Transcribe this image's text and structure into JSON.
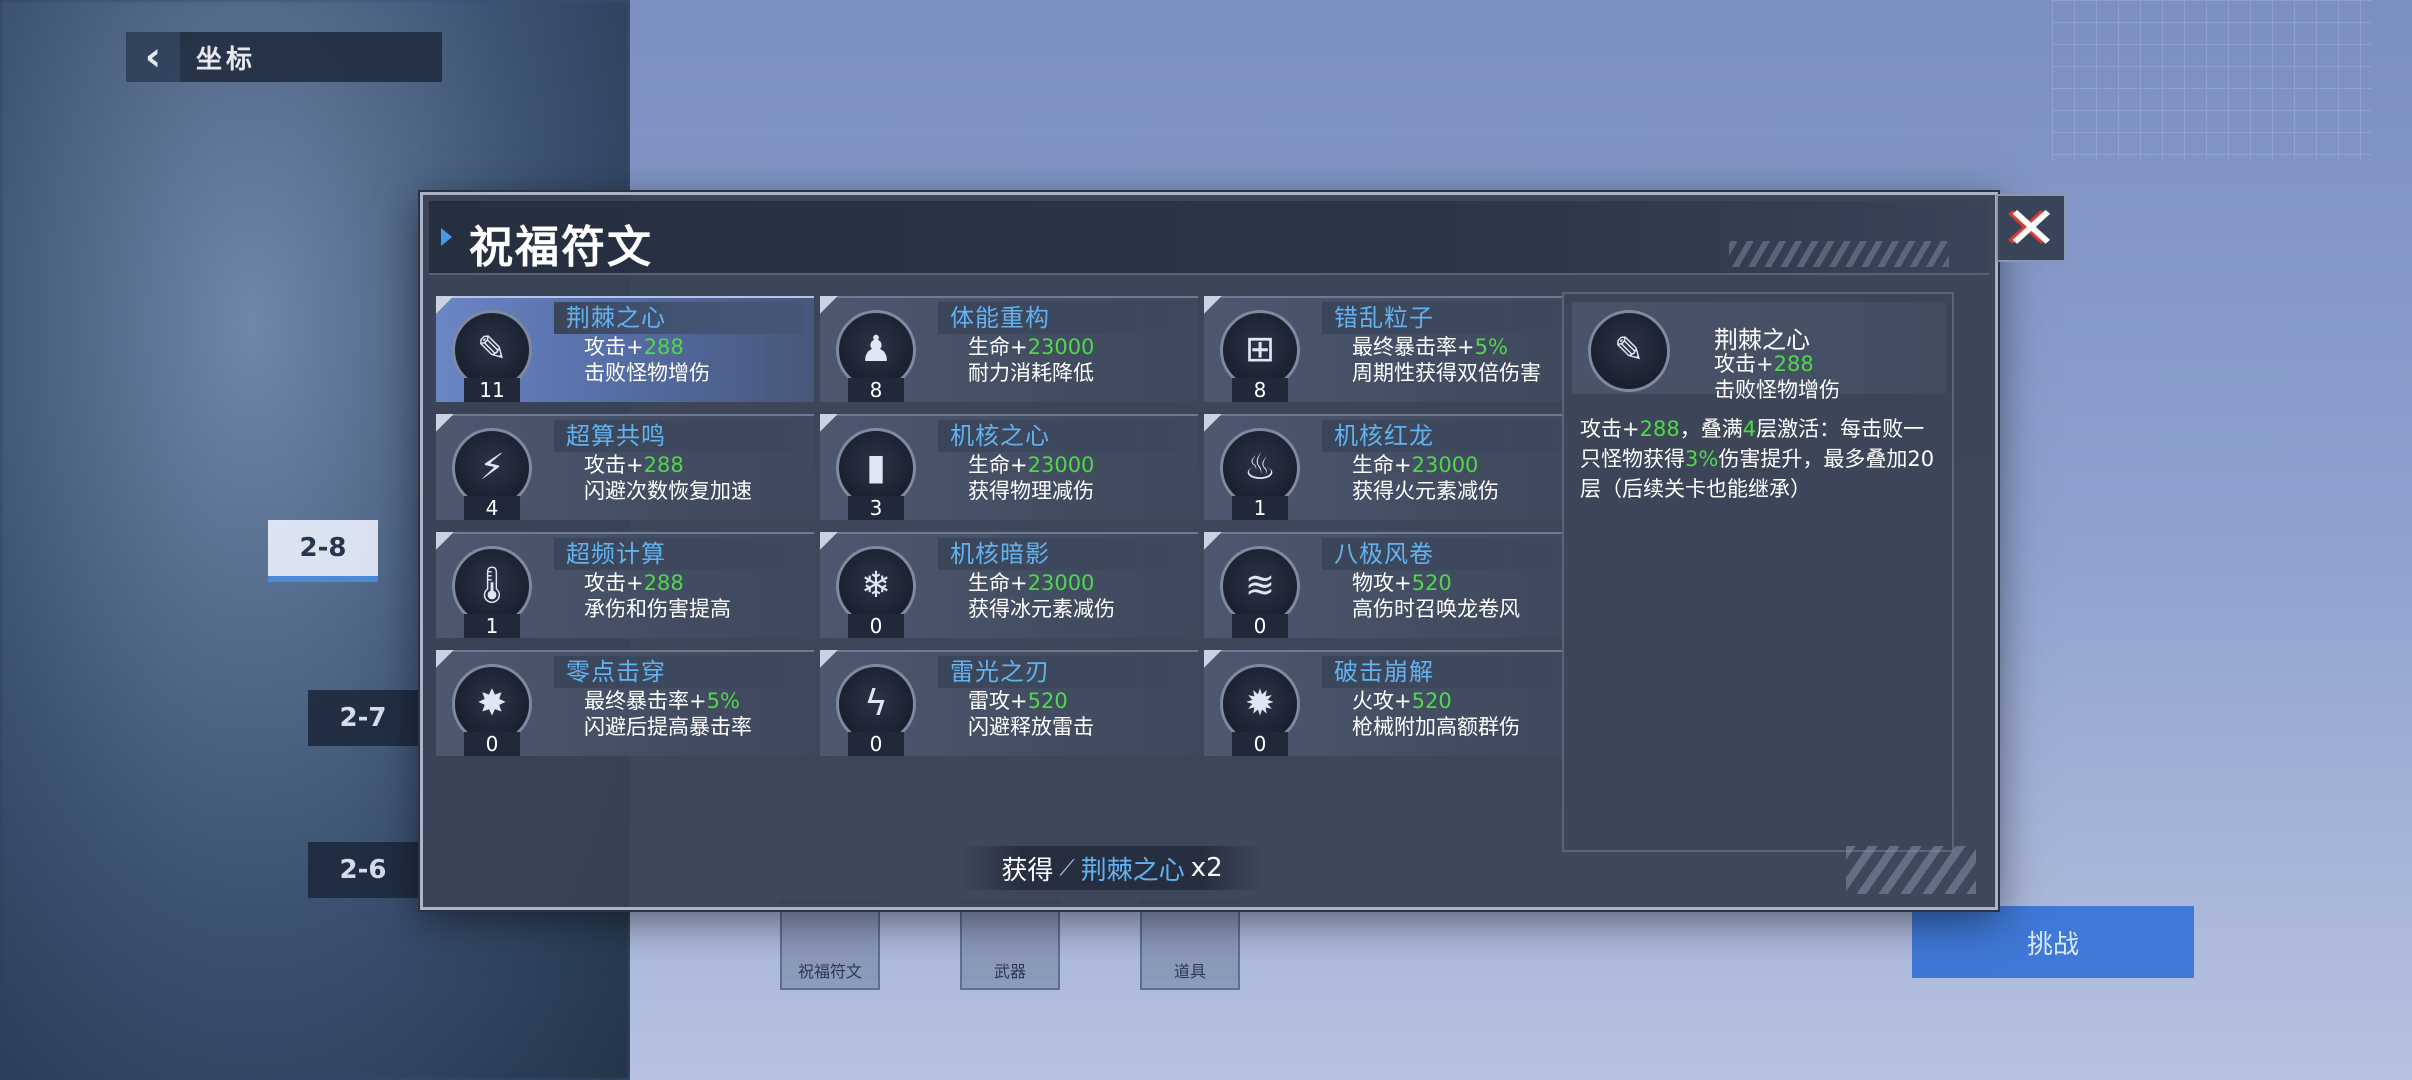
{
  "background": {
    "back_title": "坐标",
    "stages": [
      "2-8",
      "2-7",
      "2-6"
    ],
    "challenge_label": "挑战",
    "bottom_icons": [
      "祝福符文",
      "武器",
      "道具"
    ]
  },
  "modal": {
    "title": "祝福符文",
    "close_icon": "close-x-icon",
    "runes": [
      {
        "name": "荆棘之心",
        "icon": "thorn-blade-icon",
        "glyph": "✎",
        "count": "11",
        "line1_label": "攻击+",
        "line1_value": "288",
        "line2": "击败怪物增伤",
        "selected": true
      },
      {
        "name": "体能重构",
        "icon": "person-icon",
        "glyph": "♟",
        "count": "8",
        "line1_label": "生命+",
        "line1_value": "23000",
        "line2": "耐力消耗降低",
        "selected": false
      },
      {
        "name": "错乱粒子",
        "icon": "particle-capsule-icon",
        "glyph": "⊞",
        "count": "8",
        "line1_label": "最终暴击率+",
        "line1_value": "5%",
        "line2": "周期性获得双倍伤害",
        "selected": false
      },
      {
        "name": "超算共鸣",
        "icon": "dodge-figure-icon",
        "glyph": "⚡",
        "count": "4",
        "line1_label": "攻击+",
        "line1_value": "288",
        "line2": "闪避次数恢复加速",
        "selected": false
      },
      {
        "name": "机核之心",
        "icon": "core-shield-icon",
        "glyph": "▮",
        "count": "3",
        "line1_label": "生命+",
        "line1_value": "23000",
        "line2": "获得物理减伤",
        "selected": false
      },
      {
        "name": "机核红龙",
        "icon": "fire-core-icon",
        "glyph": "♨",
        "count": "1",
        "line1_label": "生命+",
        "line1_value": "23000",
        "line2": "获得火元素减伤",
        "selected": false
      },
      {
        "name": "超频计算",
        "icon": "thermometer-icon",
        "glyph": "🌡",
        "count": "1",
        "line1_label": "攻击+",
        "line1_value": "288",
        "line2": "承伤和伤害提高",
        "selected": false
      },
      {
        "name": "机核暗影",
        "icon": "ice-core-icon",
        "glyph": "❄",
        "count": "0",
        "line1_label": "生命+",
        "line1_value": "23000",
        "line2": "获得冰元素减伤",
        "selected": false
      },
      {
        "name": "八极风卷",
        "icon": "tornado-icon",
        "glyph": "≋",
        "count": "0",
        "line1_label": "物攻+",
        "line1_value": "520",
        "line2": "高伤时召唤龙卷风",
        "selected": false
      },
      {
        "name": "零点击穿",
        "icon": "pierce-burst-icon",
        "glyph": "✸",
        "count": "0",
        "line1_label": "最终暴击率+",
        "line1_value": "5%",
        "line2": "闪避后提高暴击率",
        "selected": false
      },
      {
        "name": "雷光之刃",
        "icon": "lightning-blade-icon",
        "glyph": "ϟ",
        "count": "0",
        "line1_label": "雷攻+",
        "line1_value": "520",
        "line2": "闪避释放雷击",
        "selected": false
      },
      {
        "name": "破击崩解",
        "icon": "burst-gear-icon",
        "glyph": "✹",
        "count": "0",
        "line1_label": "火攻+",
        "line1_value": "520",
        "line2": "枪械附加高额群伤",
        "selected": false
      }
    ],
    "detail": {
      "name": "荆棘之心",
      "icon": "thorn-blade-icon",
      "line1_label": "攻击+",
      "line1_value": "288",
      "line2": "击败怪物增伤",
      "desc_p1": "攻击+",
      "desc_v1": "288",
      "desc_p2": "，叠满",
      "desc_v2": "4",
      "desc_p3": "层激活：每击败一只怪物获得",
      "desc_v3": "3%",
      "desc_p4": "伤害提升，最多叠加20层（后续关卡也能继承）"
    },
    "obtain": {
      "label": "获得",
      "icon": "thorn-blade-icon",
      "item": "荆棘之心",
      "count": "x2"
    }
  },
  "colors": {
    "accent_blue": "#62b2f0",
    "value_green": "#4ed84a",
    "selected_card": "#6b86c4"
  }
}
